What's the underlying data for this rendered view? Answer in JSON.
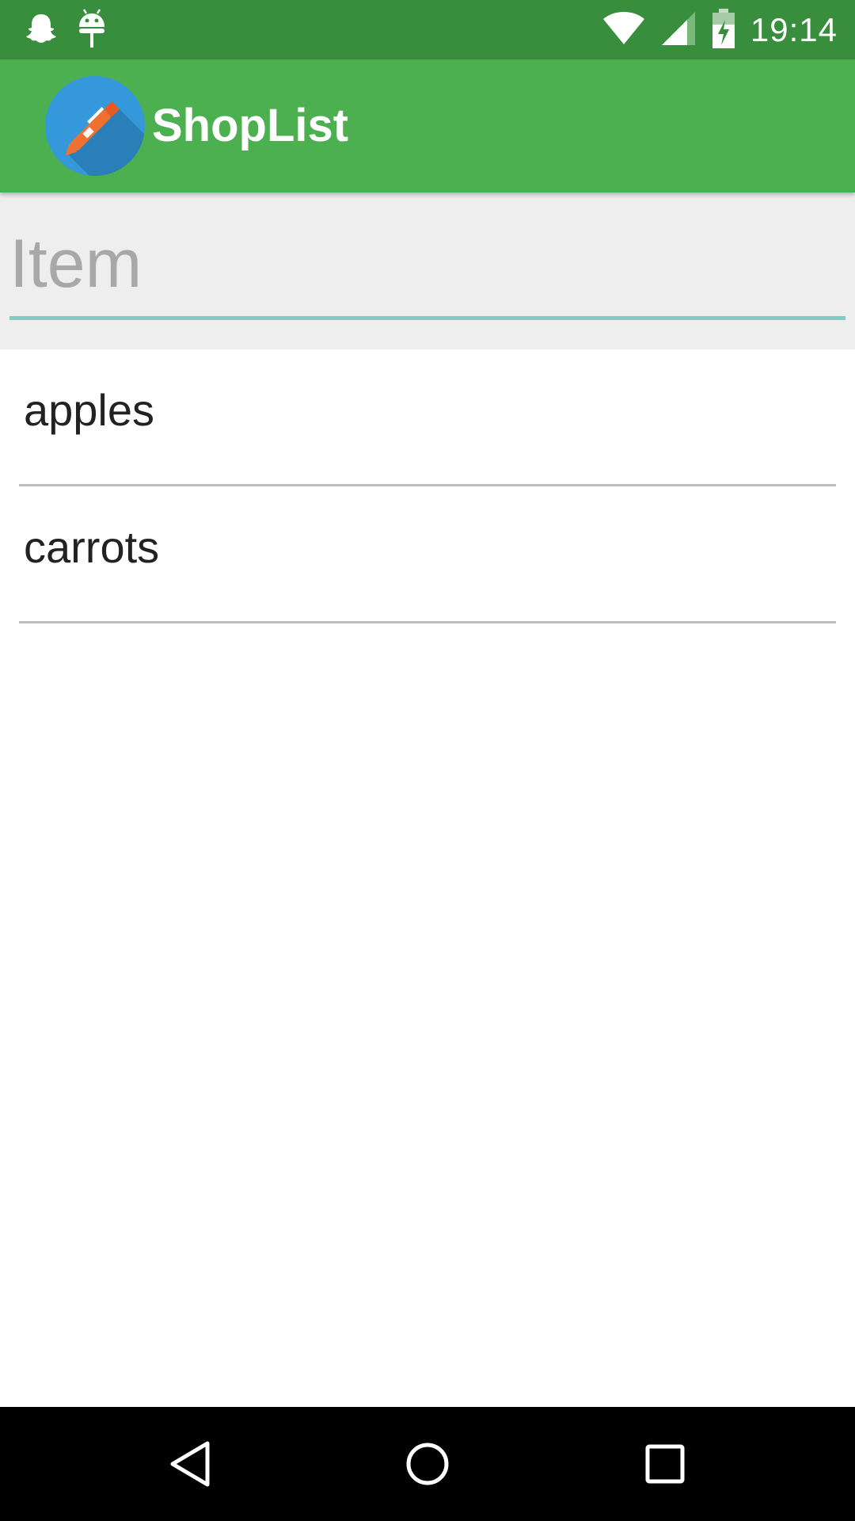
{
  "status_bar": {
    "time": "19:14",
    "notification_icons": [
      "snapchat-ghost-icon",
      "android-debug-icon"
    ],
    "system_icons": [
      "wifi-icon",
      "cell-signal-icon",
      "battery-charging-icon"
    ],
    "color": "#388e3c"
  },
  "app_bar": {
    "title": "ShopList",
    "logo_icon": "pen-logo-icon",
    "color": "#4caf50"
  },
  "input": {
    "placeholder": "Item",
    "value": "",
    "underline_color": "#80cbc4"
  },
  "list": {
    "items": [
      {
        "label": "apples"
      },
      {
        "label": "carrots"
      }
    ]
  },
  "nav_bar": {
    "buttons": [
      "back-icon",
      "home-icon",
      "recents-icon"
    ]
  }
}
